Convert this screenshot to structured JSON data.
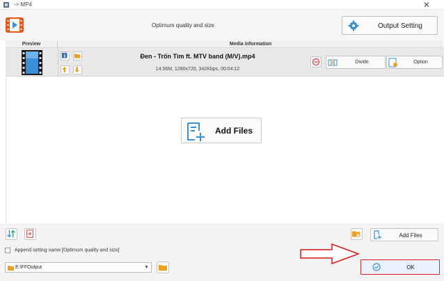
{
  "window": {
    "title": "-> MP4",
    "close_glyph": "✕"
  },
  "header": {
    "profile_label": "Optimum quality and size",
    "output_setting_label": "Output Setting"
  },
  "list": {
    "col_preview": "Preview",
    "col_media": "Media information",
    "items": [
      {
        "filename": "Đen - Trốn Tìm ft. MTV band (M/V).mp4",
        "meta": "14.56M, 1280x720, 342Kbps, 00:04:12",
        "divide_label": "Divide",
        "option_label": "Option"
      }
    ]
  },
  "add_files_big_label": "Add Files",
  "bottom": {
    "add_files_label": "Add Files",
    "append_label": "Append setting name [Optimum quality and size]",
    "output_path": "E:\\FFOutput",
    "ok_label": "OK"
  },
  "colors": {
    "accent_orange": "#f0a020",
    "accent_blue": "#3a8fd8",
    "ok_border": "#dd2222",
    "row_bg": "#e8e8e8"
  },
  "icons": [
    "app-icon",
    "video-logo-icon",
    "gear-icon",
    "film-thumbnail-icon",
    "info-icon",
    "folder-icon",
    "arrow-up-icon",
    "arrow-down-icon",
    "remove-icon",
    "divide-icon",
    "option-icon",
    "add-files-icon",
    "sort-icon",
    "clear-icon",
    "add-folder-icon",
    "folder-browse-icon",
    "checkmark-circle-icon",
    "red-arrow-annotation"
  ]
}
